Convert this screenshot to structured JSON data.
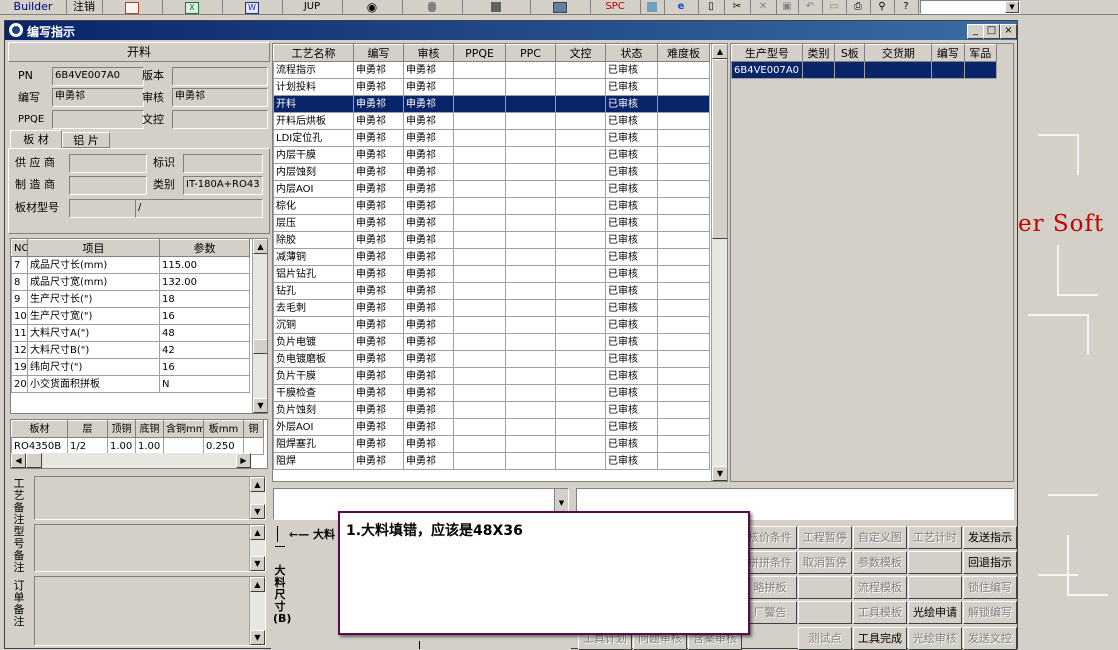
{
  "toolbar": {
    "builder_label": "Builder",
    "logout_label": "注销",
    "jup_label": "JUP",
    "spc_label": "SPC",
    "icons": [
      "ppt-icon",
      "excel-icon",
      "word-icon",
      "eye-icon",
      "database-icon",
      "network-icon",
      "computer-icon",
      "spc-icon",
      "cube-icon",
      "ie-icon",
      "new-file-icon",
      "cut-icon",
      "close-icon",
      "save-icon",
      "undo-icon",
      "preview-icon",
      "print-icon",
      "find-icon",
      "help-icon"
    ]
  },
  "desktop": {
    "bg_text": "er Soft"
  },
  "window": {
    "title": "编写指示",
    "buttons": [
      "_",
      "□",
      "×"
    ]
  },
  "left": {
    "section_title": "开料",
    "pn_label": "PN",
    "pn_value": "6B4VE007A0",
    "version_label": "版本",
    "version_value": "",
    "writer_label": "编写",
    "writer_value": "申勇祁",
    "reviewer_label": "审核",
    "reviewer_value": "申勇祁",
    "ppqe_label": "PPQE",
    "ppqe_value": "",
    "wenkong_label": "文控",
    "wenkong_value": "",
    "tabs": [
      "板 材",
      "铝 片"
    ],
    "supplier_label": "供 应 商",
    "supplier_value": "",
    "mark_label": "标识",
    "mark_value": "",
    "maker_label": "制 造 商",
    "maker_value": "",
    "category_label": "类别",
    "category_value": "IT-180A+RO43",
    "board_model_label": "板材型号",
    "board_model_value": "",
    "board_model_value2": "/",
    "param_headers": [
      "NO",
      "项目",
      "参数"
    ],
    "params": [
      {
        "no": "7",
        "item": "成品尺寸长(mm)",
        "value": "115.00"
      },
      {
        "no": "8",
        "item": "成品尺寸宽(mm)",
        "value": "132.00"
      },
      {
        "no": "9",
        "item": "生产尺寸长(\")",
        "value": "18"
      },
      {
        "no": "10",
        "item": "生产尺寸宽(\")",
        "value": "16"
      },
      {
        "no": "11",
        "item": "大料尺寸A(\")",
        "value": "48"
      },
      {
        "no": "12",
        "item": "大料尺寸B(\")",
        "value": "42"
      },
      {
        "no": "19",
        "item": "纬向尺寸(\")",
        "value": "16"
      },
      {
        "no": "20",
        "item": "小交货面积拼板",
        "value": "N"
      }
    ],
    "board_headers": [
      "板材",
      "层",
      "顶铜",
      "底铜",
      "含铜mm",
      "板mm",
      "铜"
    ],
    "board_rows": [
      {
        "c0": "RO4350B",
        "c1": "1/2",
        "c2": "1.00",
        "c3": "1.00",
        "c4": "",
        "c5": "0.250"
      }
    ],
    "notes_labels": [
      "工艺备注",
      "型号备注",
      "订单备注"
    ]
  },
  "process": {
    "headers": [
      "工艺名称",
      "编写",
      "审核",
      "PPQE",
      "PPC",
      "文控",
      "状态",
      "难度板"
    ],
    "selected_index": 2,
    "rows": [
      {
        "name": "流程指示",
        "writer": "申勇祁",
        "reviewer": "申勇祁",
        "status": "已审核"
      },
      {
        "name": "计划投料",
        "writer": "申勇祁",
        "reviewer": "申勇祁",
        "status": "已审核"
      },
      {
        "name": "开料",
        "writer": "申勇祁",
        "reviewer": "申勇祁",
        "status": "已审核"
      },
      {
        "name": "开料后烘板",
        "writer": "申勇祁",
        "reviewer": "申勇祁",
        "status": "已审核"
      },
      {
        "name": "LDI定位孔",
        "writer": "申勇祁",
        "reviewer": "申勇祁",
        "status": "已审核"
      },
      {
        "name": "内层干膜",
        "writer": "申勇祁",
        "reviewer": "申勇祁",
        "status": "已审核"
      },
      {
        "name": "内层蚀刻",
        "writer": "申勇祁",
        "reviewer": "申勇祁",
        "status": "已审核"
      },
      {
        "name": "内层AOI",
        "writer": "申勇祁",
        "reviewer": "申勇祁",
        "status": "已审核"
      },
      {
        "name": "棕化",
        "writer": "申勇祁",
        "reviewer": "申勇祁",
        "status": "已审核"
      },
      {
        "name": "层压",
        "writer": "申勇祁",
        "reviewer": "申勇祁",
        "status": "已审核"
      },
      {
        "name": "除胶",
        "writer": "申勇祁",
        "reviewer": "申勇祁",
        "status": "已审核"
      },
      {
        "name": "减薄铜",
        "writer": "申勇祁",
        "reviewer": "申勇祁",
        "status": "已审核"
      },
      {
        "name": "铝片钻孔",
        "writer": "申勇祁",
        "reviewer": "申勇祁",
        "status": "已审核"
      },
      {
        "name": "钻孔",
        "writer": "申勇祁",
        "reviewer": "申勇祁",
        "status": "已审核"
      },
      {
        "name": "去毛刺",
        "writer": "申勇祁",
        "reviewer": "申勇祁",
        "status": "已审核"
      },
      {
        "name": "沉铜",
        "writer": "申勇祁",
        "reviewer": "申勇祁",
        "status": "已审核"
      },
      {
        "name": "负片电镀",
        "writer": "申勇祁",
        "reviewer": "申勇祁",
        "status": "已审核"
      },
      {
        "name": "负电镀磨板",
        "writer": "申勇祁",
        "reviewer": "申勇祁",
        "status": "已审核"
      },
      {
        "name": "负片干膜",
        "writer": "申勇祁",
        "reviewer": "申勇祁",
        "status": "已审核"
      },
      {
        "name": "干膜检查",
        "writer": "申勇祁",
        "reviewer": "申勇祁",
        "status": "已审核"
      },
      {
        "name": "负片蚀刻",
        "writer": "申勇祁",
        "reviewer": "申勇祁",
        "status": "已审核"
      },
      {
        "name": "外层AOI",
        "writer": "申勇祁",
        "reviewer": "申勇祁",
        "status": "已审核"
      },
      {
        "name": "阻焊塞孔",
        "writer": "申勇祁",
        "reviewer": "申勇祁",
        "status": "已审核"
      },
      {
        "name": "阻焊",
        "writer": "申勇祁",
        "reviewer": "申勇祁",
        "status": "已审核"
      }
    ]
  },
  "model_table": {
    "headers": [
      "生产型号",
      "类别",
      "S板",
      "交货期",
      "编写",
      "军品"
    ],
    "rows": [
      {
        "model": "6B4VE007A0"
      }
    ]
  },
  "drawing": {
    "arrow_label": "大料",
    "vertical_label": "大料尺寸(B)"
  },
  "popup": {
    "message": "1.大料填错，应该是48X36"
  },
  "buttons": {
    "row1": [
      "核价条件",
      "工程暂停",
      "自定义图",
      "工艺计时",
      "发送指示"
    ],
    "row2": [
      "拼拼条件",
      "取消暂停",
      "参数模板",
      "",
      "回退指示"
    ],
    "row3": [
      "略拼板",
      "",
      "流程模板",
      "",
      "锁住编写"
    ],
    "row4": [
      "厂警告",
      "",
      "工具模板",
      "光绘申请",
      "解锁编写"
    ],
    "row5": [
      "工具计划",
      "问题审核",
      "含案审核",
      "测试点",
      "工具完成",
      "光绘审核",
      "发送文控"
    ]
  }
}
